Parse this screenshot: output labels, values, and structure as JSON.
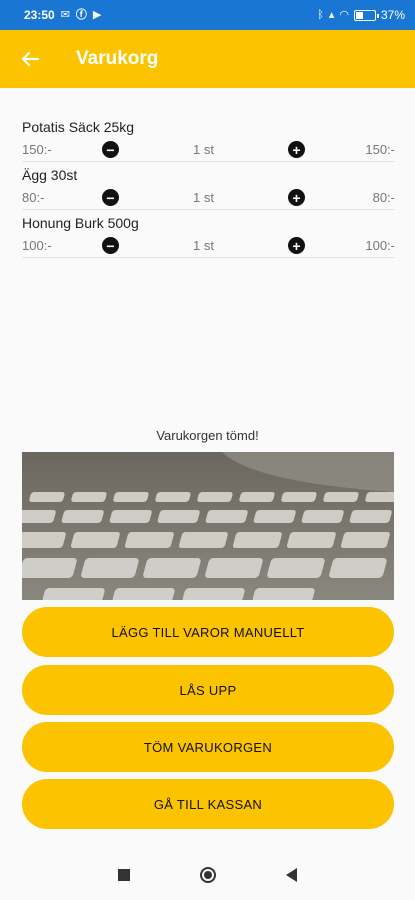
{
  "status_bar": {
    "time": "23:50",
    "battery_pct": "37",
    "battery_pct_suffix": "%",
    "battery_level": 0.37,
    "icons": [
      "message-icon",
      "facebook-icon",
      "youtube-icon",
      "bluetooth-icon",
      "signal-icon",
      "wifi-icon"
    ]
  },
  "app_bar": {
    "back_icon": "arrow-left-icon",
    "title": "Varukorg"
  },
  "cart": {
    "items": [
      {
        "name": "Potatis Säck 25kg",
        "price": "150:-",
        "quantity": "1 st",
        "total": "150:-"
      },
      {
        "name": "Ägg 30st",
        "price": "80:-",
        "quantity": "1 st",
        "total": "80:-"
      },
      {
        "name": "Honung Burk 500g",
        "price": "100:-",
        "quantity": "1 st",
        "total": "100:-"
      }
    ],
    "minus_icon": "minus-circle-icon",
    "plus_icon": "plus-circle-icon"
  },
  "message": "Varukorgen tömd!",
  "camera_preview": "keyboard-photo",
  "buttons": {
    "add_manual": "LÄGG TILL VAROR MANUELLT",
    "unlock": "LÅS UPP",
    "empty_cart": "TÖM VARUKORGEN",
    "checkout": "GÅ TILL KASSAN"
  },
  "nav_bar": {
    "icons": [
      "recents-square-icon",
      "home-circle-icon",
      "back-triangle-icon"
    ]
  }
}
